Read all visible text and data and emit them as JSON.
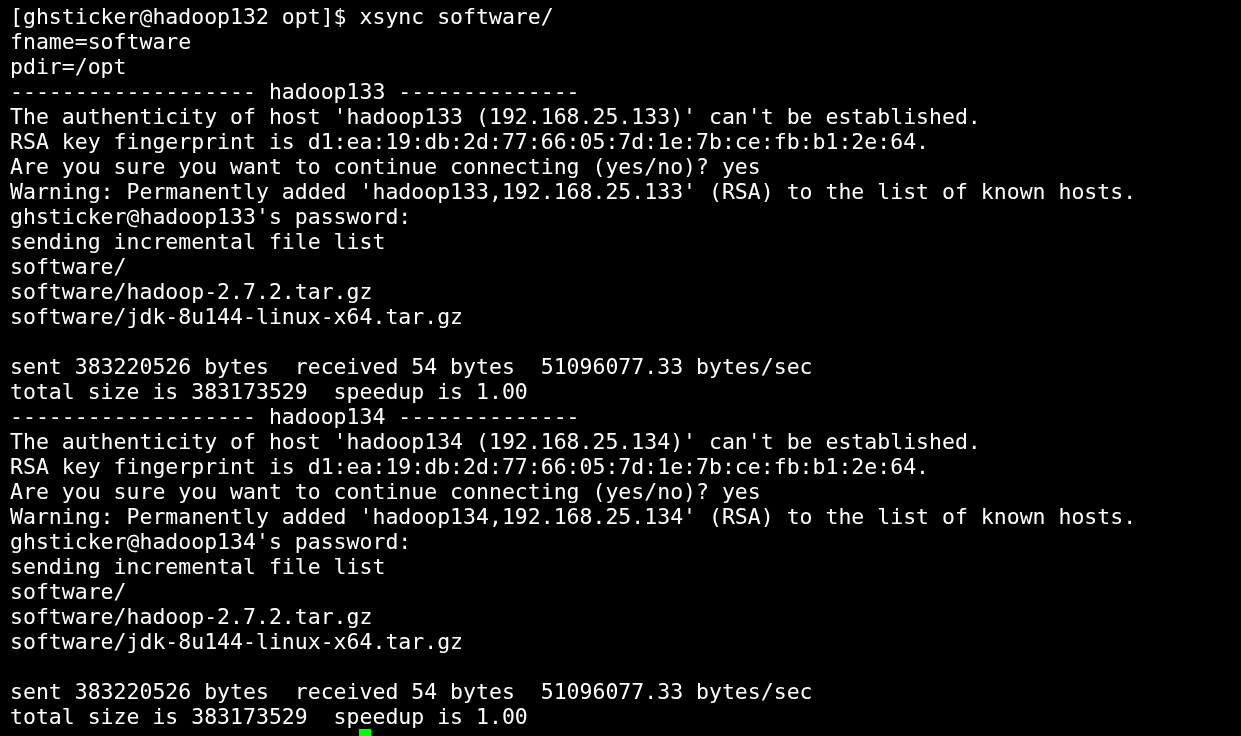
{
  "terminal": {
    "lines": [
      {
        "kind": "text",
        "text": "[ghsticker@hadoop132 opt]$ xsync software/"
      },
      {
        "kind": "text",
        "text": "fname=software"
      },
      {
        "kind": "text",
        "text": "pdir=/opt"
      },
      {
        "kind": "text",
        "text": "------------------- hadoop133 --------------"
      },
      {
        "kind": "text",
        "text": "The authenticity of host 'hadoop133 (192.168.25.133)' can't be established."
      },
      {
        "kind": "text",
        "text": "RSA key fingerprint is d1:ea:19:db:2d:77:66:05:7d:1e:7b:ce:fb:b1:2e:64."
      },
      {
        "kind": "text",
        "text": "Are you sure you want to continue connecting (yes/no)? yes"
      },
      {
        "kind": "text",
        "text": "Warning: Permanently added 'hadoop133,192.168.25.133' (RSA) to the list of known hosts."
      },
      {
        "kind": "text",
        "text": "ghsticker@hadoop133's password:"
      },
      {
        "kind": "text",
        "text": "sending incremental file list"
      },
      {
        "kind": "text",
        "text": "software/"
      },
      {
        "kind": "text",
        "text": "software/hadoop-2.7.2.tar.gz"
      },
      {
        "kind": "text",
        "text": "software/jdk-8u144-linux-x64.tar.gz"
      },
      {
        "kind": "blank"
      },
      {
        "kind": "text",
        "text": "sent 383220526 bytes  received 54 bytes  51096077.33 bytes/sec"
      },
      {
        "kind": "text",
        "text": "total size is 383173529  speedup is 1.00"
      },
      {
        "kind": "text",
        "text": "------------------- hadoop134 --------------"
      },
      {
        "kind": "text",
        "text": "The authenticity of host 'hadoop134 (192.168.25.134)' can't be established."
      },
      {
        "kind": "text",
        "text": "RSA key fingerprint is d1:ea:19:db:2d:77:66:05:7d:1e:7b:ce:fb:b1:2e:64."
      },
      {
        "kind": "text",
        "text": "Are you sure you want to continue connecting (yes/no)? yes"
      },
      {
        "kind": "text",
        "text": "Warning: Permanently added 'hadoop134,192.168.25.134' (RSA) to the list of known hosts."
      },
      {
        "kind": "text",
        "text": "ghsticker@hadoop134's password:"
      },
      {
        "kind": "text",
        "text": "sending incremental file list"
      },
      {
        "kind": "text",
        "text": "software/"
      },
      {
        "kind": "text",
        "text": "software/hadoop-2.7.2.tar.gz"
      },
      {
        "kind": "text",
        "text": "software/jdk-8u144-linux-x64.tar.gz"
      },
      {
        "kind": "blank"
      },
      {
        "kind": "text",
        "text": "sent 383220526 bytes  received 54 bytes  51096077.33 bytes/sec"
      },
      {
        "kind": "text",
        "text": "total size is 383173529  speedup is 1.00"
      }
    ],
    "cursor": true
  }
}
